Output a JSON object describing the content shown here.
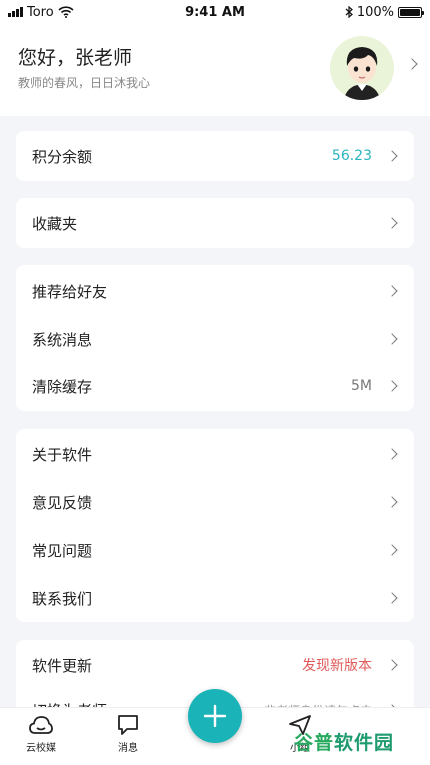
{
  "status_bar": {
    "carrier": "Toro",
    "time": "9:41 AM",
    "battery": "100%"
  },
  "profile": {
    "greeting": "您好，张老师",
    "motto": "教师的春风，日日沐我心"
  },
  "cards": {
    "points": {
      "label": "积分余额",
      "value": "56.23"
    },
    "favorites": {
      "label": "收藏夹"
    },
    "group2": {
      "recommend": {
        "label": "推荐给好友"
      },
      "messages": {
        "label": "系统消息"
      },
      "cache": {
        "label": "清除缓存",
        "value": "5M"
      }
    },
    "group3": {
      "about": {
        "label": "关于软件"
      },
      "feedback": {
        "label": "意见反馈"
      },
      "faq": {
        "label": "常见问题"
      },
      "contact": {
        "label": "联系我们"
      }
    },
    "group4": {
      "update": {
        "label": "软件更新",
        "value": "发现新版本"
      },
      "switch": {
        "label": "切换为老师",
        "value": "非老师身份请勿点击"
      }
    }
  },
  "tabbar": {
    "cloud": {
      "label": "云校媒"
    },
    "messages": {
      "label": "消息"
    },
    "small": {
      "label": "小组"
    }
  },
  "watermark": {
    "text_a": "谷普",
    "text_b": "软件园"
  },
  "colors": {
    "accent": "#1ab3b8",
    "points_value": "#2bb3c0",
    "update_value": "#e05a5a"
  },
  "icons": {
    "wifi": "wifi-icon",
    "bluetooth": "bluetooth-icon",
    "cloud": "cloud-icon",
    "chat": "chat-bubble-icon",
    "plus": "plus-icon"
  }
}
